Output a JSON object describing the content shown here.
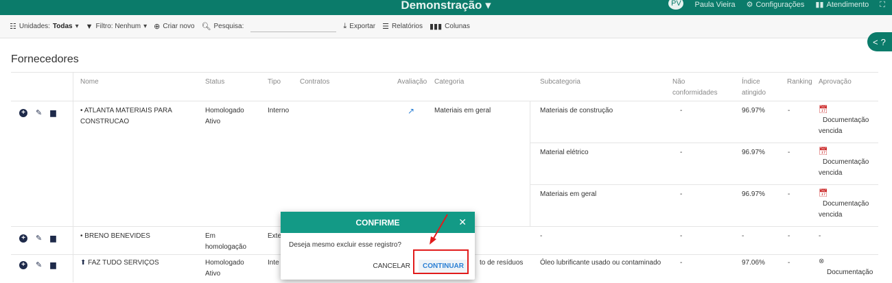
{
  "topbar": {
    "brand": "Demonstração ▾",
    "avatar_initials": "PV",
    "user": "Paula Vieira",
    "settings": "Configurações",
    "support": "Atendimento"
  },
  "toolbar": {
    "units_label": "Unidades:",
    "units_value": "Todas",
    "filter_label": "Filtro: Nenhum",
    "create_new": "Criar novo",
    "search_label": "Pesquisa:",
    "export": "Exportar",
    "reports": "Relatórios",
    "columns": "Colunas"
  },
  "help_tab": {
    "left": "<",
    "right": "?"
  },
  "page_title": "Fornecedores",
  "table": {
    "headers": {
      "nome": "Nome",
      "status": "Status",
      "tipo": "Tipo",
      "contratos": "Contratos",
      "avaliacao": "Avaliação",
      "categoria": "Categoria",
      "subcategoria": "Subcategoria",
      "nao_conf_1": "Não",
      "nao_conf_2": "conformidades",
      "indice_1": "Índice",
      "indice_2": "atingido",
      "ranking": "Ranking",
      "aprovacao": "Aprovação"
    },
    "rows": [
      {
        "nome_1": "• ATLANTA MATERIAIS PARA",
        "nome_2": "CONSTRUCAO",
        "status_1": "Homologado",
        "status_2": "Ativo",
        "tipo": "Interno",
        "categoria": "Materiais em geral",
        "subrows": [
          {
            "sub": "Materiais de construção",
            "nc": "-",
            "indice": "96.97%",
            "rank": "-",
            "apr_1": "Documentação",
            "apr_2": "vencida"
          },
          {
            "sub": "Material elétrico",
            "nc": "-",
            "indice": "96.97%",
            "rank": "-",
            "apr_1": "Documentação",
            "apr_2": "vencida"
          },
          {
            "sub": "Materiais em geral",
            "nc": "-",
            "indice": "96.97%",
            "rank": "-",
            "apr_1": "Documentação",
            "apr_2": "vencida"
          }
        ]
      },
      {
        "nome_1": "• BRENO BENEVIDES",
        "status_1": "Em",
        "status_2": "homologação",
        "tipo": "Exte",
        "sub": "-",
        "nc": "-",
        "indice": "-",
        "rank": "-",
        "apr": "-"
      },
      {
        "nome_1": "FAZ TUDO SERVIÇOS",
        "status_1": "Homologado",
        "status_2": "Ativo",
        "tipo": "Inte",
        "categoria_frag": "to de resíduos",
        "sub": "Óleo lubrificante usado ou contaminado",
        "nc": "-",
        "indice": "97.06%",
        "rank": "-",
        "apr": "Documentação"
      }
    ]
  },
  "modal": {
    "title": "CONFIRME",
    "message": "Deseja mesmo excluir esse registro?",
    "cancel": "CANCELAR",
    "continue": "CONTINUAR"
  },
  "colors": {
    "primary": "#0b7b6a",
    "modal_header": "#139a86",
    "highlight": "#e11b1b",
    "link": "#2a7fd4"
  }
}
